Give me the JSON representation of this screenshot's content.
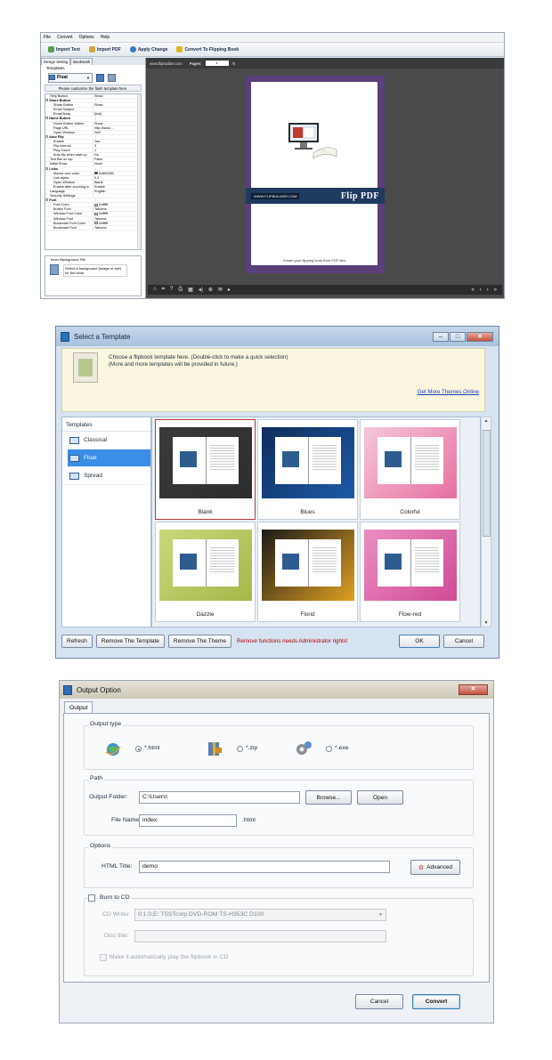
{
  "editor": {
    "menu": [
      "File",
      "Convert",
      "Options",
      "Help"
    ],
    "toolbar": [
      "Import Text",
      "Import PDF",
      "Apply Change",
      "Convert To Flipping Book"
    ],
    "left_tabs": [
      "Design Setting",
      "Bookmark"
    ],
    "templates_label": "Templates",
    "template_value": "Float",
    "customize_label": "Please customize the flash template here.",
    "properties": [
      {
        "k": "Help Button",
        "v": "Show",
        "indent": 1,
        "group": false
      },
      {
        "k": "Share Button",
        "v": "",
        "indent": 0,
        "group": true
      },
      {
        "k": "Share Button",
        "v": "Show",
        "indent": 2,
        "group": false
      },
      {
        "k": "Email Subject",
        "v": "",
        "indent": 2,
        "group": false
      },
      {
        "k": "Email Body",
        "v": "{link}",
        "indent": 2,
        "group": false
      },
      {
        "k": "Home Button",
        "v": "",
        "indent": 0,
        "group": true
      },
      {
        "k": "Home Button Visible",
        "v": "Show",
        "indent": 2,
        "group": false
      },
      {
        "k": "Page URL",
        "v": "http://www....",
        "indent": 2,
        "group": false
      },
      {
        "k": "Open Window",
        "v": "Self",
        "indent": 2,
        "group": false
      },
      {
        "k": "Auto Flip",
        "v": "",
        "indent": 0,
        "group": true
      },
      {
        "k": "Enable",
        "v": "Yes",
        "indent": 2,
        "group": false
      },
      {
        "k": "Flip Interval",
        "v": "3",
        "indent": 2,
        "group": false
      },
      {
        "k": "Play Count",
        "v": "1",
        "indent": 2,
        "group": false
      },
      {
        "k": "Auto flip when start up",
        "v": "No",
        "indent": 2,
        "group": false
      },
      {
        "k": "Tool Bar on top",
        "v": "False",
        "indent": 1,
        "group": false
      },
      {
        "k": "Initial Show",
        "v": "None",
        "indent": 1,
        "group": false
      },
      {
        "k": "Links",
        "v": "",
        "indent": 0,
        "group": true
      },
      {
        "k": "Mouse over color",
        "v": "0x800080",
        "indent": 2,
        "group": false,
        "swatch": "#800080"
      },
      {
        "k": "Link alpha",
        "v": "0.2",
        "indent": 2,
        "group": false
      },
      {
        "k": "Open Window",
        "v": "Blank",
        "indent": 2,
        "group": false
      },
      {
        "k": "Enable after zooming in",
        "v": "Enable",
        "indent": 2,
        "group": false
      },
      {
        "k": "Language",
        "v": "English",
        "indent": 1,
        "group": false
      },
      {
        "k": "Security Settings",
        "v": "",
        "indent": 1,
        "group": false
      },
      {
        "k": "Font",
        "v": "",
        "indent": 0,
        "group": true
      },
      {
        "k": "Font Color",
        "v": "0xffffff",
        "indent": 2,
        "group": false,
        "swatch": "#ffffff"
      },
      {
        "k": "Button Font",
        "v": "Tahoma",
        "indent": 2,
        "group": false
      },
      {
        "k": "Window Font Color",
        "v": "0xffffff",
        "indent": 2,
        "group": false,
        "swatch": "#ffffff"
      },
      {
        "k": "Window Font",
        "v": "Tahoma",
        "indent": 2,
        "group": false
      },
      {
        "k": "Bookmark Font Color",
        "v": "0xffffff",
        "indent": 2,
        "group": false,
        "swatch": "#ffffff"
      },
      {
        "k": "Bookmark Font",
        "v": "Tahoma",
        "indent": 2,
        "group": false
      }
    ],
    "bg_file_title": "Inner Background File",
    "bg_file_desc": "Select a background (image or swf) for the book",
    "stage_url": "www.flipbuilder.com",
    "pages_label": "Pages:",
    "page_value": "1",
    "page_total": "/6",
    "cover_url": "WWW.FLIPBUILDER.COM",
    "cover_brand": "Flip PDF",
    "cover_caption": "Create your flipping book from PDF files"
  },
  "template_dialog": {
    "title": "Select a Template",
    "info_line1": "Choose a flipbook template here. (Double-click to make a quick selection)",
    "info_line2": "(More and more templates will be provided in future.)",
    "more_link": "Get More Themes Online",
    "list_header": "Templates",
    "list": [
      "Classical",
      "Float",
      "Spread"
    ],
    "selected": "Float",
    "themes": [
      {
        "name": "Blank",
        "bg": "#3a3a3a",
        "accent": "#2d2d2d"
      },
      {
        "name": "Blues",
        "bg": "#0f2c5c",
        "accent": "#1d5aa8"
      },
      {
        "name": "Colorful",
        "bg": "#f4c7d9",
        "accent": "#e76fa0"
      },
      {
        "name": "Dazzle",
        "bg": "#c9d87a",
        "accent": "#a4b84a"
      },
      {
        "name": "Florid",
        "bg": "#1a1a1a",
        "accent": "#e0a020"
      },
      {
        "name": "Flow-red",
        "bg": "#ea8fc2",
        "accent": "#d14a96"
      }
    ],
    "buttons": {
      "refresh": "Refresh",
      "remove_template": "Remove The Template",
      "remove_theme": "Remove The Theme",
      "ok": "OK",
      "cancel": "Cancel"
    },
    "warning": "Remove functions needs Administrator rights!"
  },
  "output_dialog": {
    "title": "Output Option",
    "tab": "Output",
    "output_type_label": "Output type",
    "types": [
      {
        "label": "*.html",
        "checked": true
      },
      {
        "label": "*.zip",
        "checked": false
      },
      {
        "label": "*.exe",
        "checked": false
      }
    ],
    "path_label": "Path",
    "output_folder_label": "Output Folder:",
    "output_folder_value": "C:\\Users\\",
    "browse": "Browse...",
    "open": "Open",
    "file_name_label": "File Name:",
    "file_name_value": "index",
    "file_ext": ".html",
    "options_label": "Options",
    "html_title_label": "HTML Title:",
    "html_title_value": "demo",
    "advanced": "Advanced",
    "burn_label": "Burn to CD",
    "cd_writer_label": "CD Writer",
    "cd_writer_value": "0:1:0,E: TSSTcorp DVD-ROM TS-H353C D100",
    "disc_title_label": "Disc title:",
    "autoplay_label": "Make it automatically play the flipbook in CD",
    "cancel": "Cancel",
    "convert": "Convert"
  }
}
